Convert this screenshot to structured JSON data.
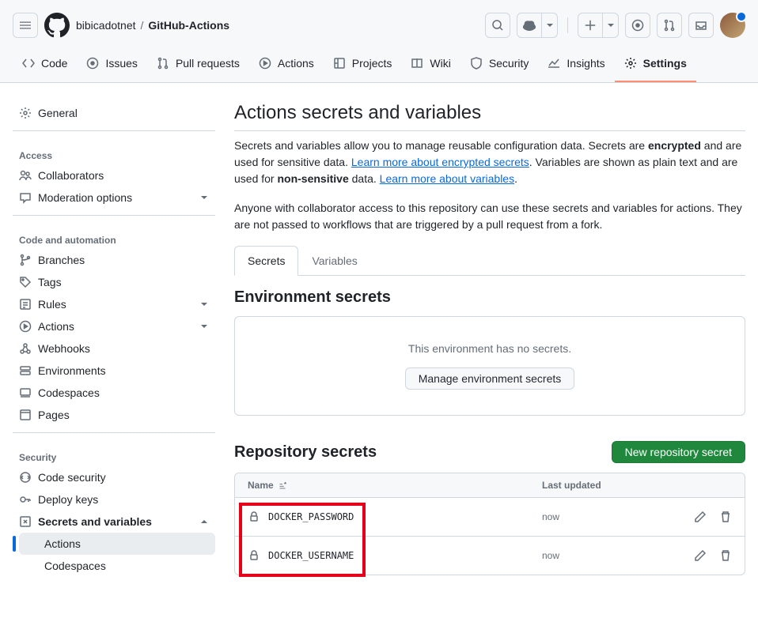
{
  "header": {
    "owner": "bibicadotnet",
    "repo": "GitHub-Actions"
  },
  "tabs": [
    {
      "label": "Code"
    },
    {
      "label": "Issues"
    },
    {
      "label": "Pull requests"
    },
    {
      "label": "Actions"
    },
    {
      "label": "Projects"
    },
    {
      "label": "Wiki"
    },
    {
      "label": "Security"
    },
    {
      "label": "Insights"
    },
    {
      "label": "Settings"
    }
  ],
  "sidebar": {
    "general": "General",
    "access_hdr": "Access",
    "collaborators": "Collaborators",
    "moderation": "Moderation options",
    "code_hdr": "Code and automation",
    "branches": "Branches",
    "tags": "Tags",
    "rules": "Rules",
    "actions": "Actions",
    "webhooks": "Webhooks",
    "environments": "Environments",
    "codespaces": "Codespaces",
    "pages": "Pages",
    "security_hdr": "Security",
    "code_security": "Code security",
    "deploy_keys": "Deploy keys",
    "secrets_vars": "Secrets and variables",
    "sub_actions": "Actions",
    "sub_codespaces": "Codespaces"
  },
  "page": {
    "title": "Actions secrets and variables",
    "desc_p1_a": "Secrets and variables allow you to manage reusable configuration data. Secrets are ",
    "desc_p1_b": "encrypted",
    "desc_p1_c": " and are used for sensitive data. ",
    "desc_link1": "Learn more about encrypted secrets",
    "desc_p1_d": ". Variables are shown as plain text and are used for ",
    "desc_p1_e": "non-sensitive",
    "desc_p1_f": " data. ",
    "desc_link2": "Learn more about variables",
    "desc_p1_g": ".",
    "desc_p2": "Anyone with collaborator access to this repository can use these secrets and variables for actions. They are not passed to workflows that are triggered by a pull request from a fork.",
    "subtab_secrets": "Secrets",
    "subtab_variables": "Variables",
    "env_title": "Environment secrets",
    "env_empty": "This environment has no secrets.",
    "env_btn": "Manage environment secrets",
    "repo_title": "Repository secrets",
    "new_btn": "New repository secret",
    "th_name": "Name",
    "th_updated": "Last updated",
    "secrets": [
      {
        "name": "DOCKER_PASSWORD",
        "updated": "now"
      },
      {
        "name": "DOCKER_USERNAME",
        "updated": "now"
      }
    ]
  }
}
